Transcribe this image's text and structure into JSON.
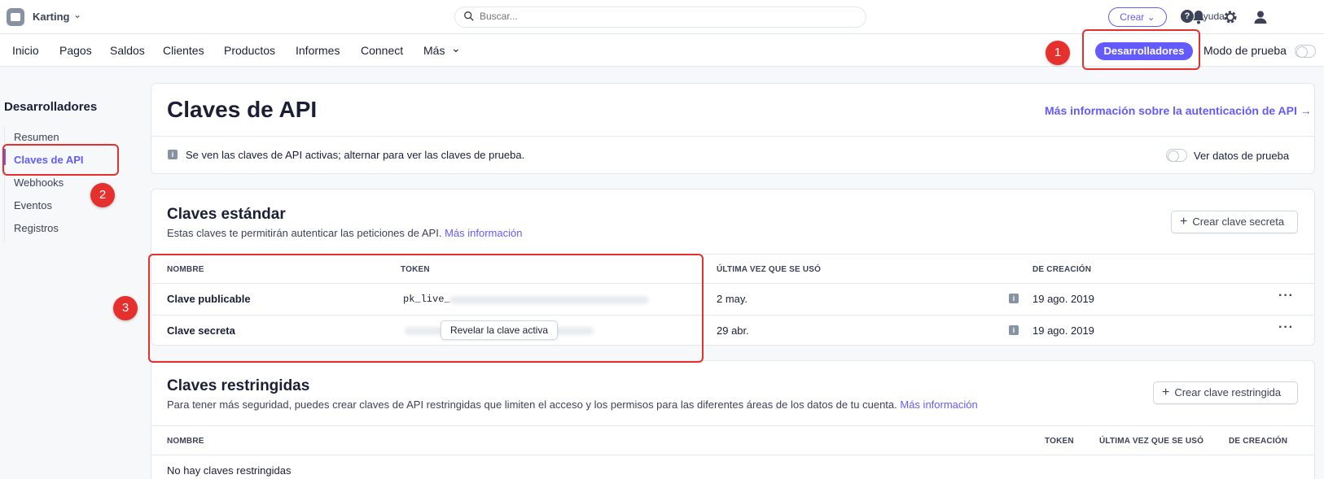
{
  "topbar": {
    "account_name": "Karting",
    "search_placeholder": "Buscar...",
    "create_label": "Crear",
    "help_label": "Ayuda"
  },
  "nav": {
    "items": [
      "Inicio",
      "Pagos",
      "Saldos",
      "Clientes",
      "Productos",
      "Informes",
      "Connect",
      "Más"
    ],
    "developers_label": "Desarrolladores",
    "test_mode_label": "Modo de prueba"
  },
  "sidebar": {
    "title": "Desarrolladores",
    "items": [
      "Resumen",
      "Claves de API",
      "Webhooks",
      "Eventos",
      "Registros"
    ],
    "active_index": 1
  },
  "page": {
    "title": "Claves de API",
    "more_link": "Más información sobre la autenticación de API",
    "notice": "Se ven las claves de API activas; alternar para ver las claves de prueba.",
    "view_test_label": "Ver datos de prueba"
  },
  "standard": {
    "title": "Claves estándar",
    "desc": "Estas claves te permitirán autenticar las peticiones de API.",
    "desc_link": "Más información",
    "create_button": "Crear clave secreta",
    "headers": [
      "NOMBRE",
      "TOKEN",
      "ÚLTIMA VEZ QUE SE USÓ",
      "DE CREACIÓN"
    ],
    "rows": [
      {
        "name": "Clave publicable",
        "token": "pk_live_",
        "last_used": "2 may.",
        "created": "19 ago. 2019"
      },
      {
        "name": "Clave secreta",
        "token": "sk_live_",
        "reveal": "Revelar la clave activa",
        "last_used": "29 abr.",
        "created": "19 ago. 2019"
      }
    ]
  },
  "restricted": {
    "title": "Claves restringidas",
    "desc": "Para tener más seguridad, puedes crear claves de API restringidas que limiten el acceso y los permisos para las diferentes áreas de los datos de tu cuenta.",
    "desc_link": "Más información",
    "create_button": "Crear clave restringida",
    "headers": [
      "NOMBRE",
      "TOKEN",
      "ÚLTIMA VEZ QUE SE USÓ",
      "DE CREACIÓN"
    ],
    "empty": "No hay claves restringidas"
  },
  "annotations": [
    "1",
    "2",
    "3"
  ],
  "colors": {
    "accent": "#635bff",
    "annotation": "#e5302e"
  }
}
